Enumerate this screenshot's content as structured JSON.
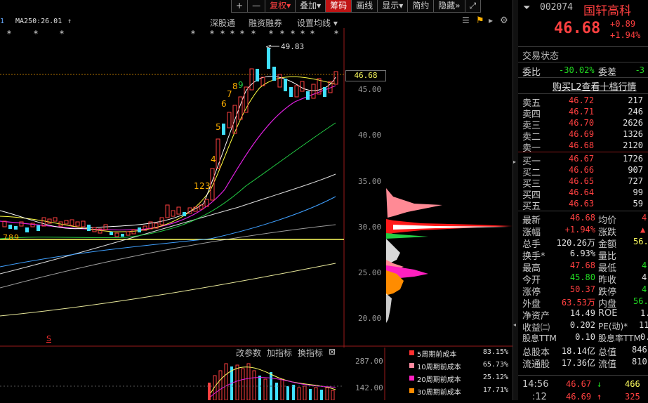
{
  "toolbar": {
    "buttons": [
      "+",
      "—",
      "复权",
      "叠加",
      "筹码",
      "画线",
      "显示",
      "简约",
      "隐藏"
    ],
    "more": "»",
    "expand": "⤢"
  },
  "chart_header": {
    "ma250": "MA250:26.01",
    "arrow": "↑",
    "menu1": "深股通",
    "menu2": "融资融券",
    "menu3": "设置均线",
    "annot_high": "49.83",
    "price_tag": "46.68",
    "nums": [
      "4",
      "5",
      "6",
      "7",
      "8",
      "9",
      "1",
      "2",
      "3"
    ],
    "seq_left": "789",
    "s_marker": "S"
  },
  "y_axis": [
    "45.00",
    "40.00",
    "35.00",
    "30.00",
    "25.00",
    "20.00"
  ],
  "sub_axis": [
    "287.00",
    "142.00"
  ],
  "sub_menu": [
    "改参数",
    "加指标",
    "换指标"
  ],
  "sub_close": "⊠",
  "legend": [
    {
      "name": "5周期前成本",
      "value": "83.15%",
      "color": "#ff3030"
    },
    {
      "name": "10周期前成本",
      "value": "65.73%",
      "color": "#ff8aa0"
    },
    {
      "name": "20周期前成本",
      "value": "25.12%",
      "color": "#ff20c0"
    },
    {
      "name": "30周期前成本",
      "value": "17.71%",
      "color": "#ff8c00"
    }
  ],
  "side": {
    "code": "002074",
    "name": "国轩高科",
    "price": "46.68",
    "change": "+0.89",
    "pct": "+1.94%",
    "status": "交易状态",
    "weibi_label": "委比",
    "weibi_value": "-30.02%",
    "weicha_label": "委差",
    "weicha_value": "-3",
    "l2_link": "购买L2查看十档行情",
    "asks": [
      {
        "label": "卖五",
        "price": "46.72",
        "vol": "217"
      },
      {
        "label": "卖四",
        "price": "46.71",
        "vol": "246"
      },
      {
        "label": "卖三",
        "price": "46.70",
        "vol": "2626"
      },
      {
        "label": "卖二",
        "price": "46.69",
        "vol": "1326"
      },
      {
        "label": "卖一",
        "price": "46.68",
        "vol": "2120"
      }
    ],
    "bids": [
      {
        "label": "买一",
        "price": "46.67",
        "vol": "1726"
      },
      {
        "label": "买二",
        "price": "46.66",
        "vol": "907"
      },
      {
        "label": "买三",
        "price": "46.65",
        "vol": "727"
      },
      {
        "label": "买四",
        "price": "46.64",
        "vol": "99"
      },
      {
        "label": "买五",
        "price": "46.63",
        "vol": "59"
      }
    ],
    "stats": [
      {
        "l1": "最新",
        "v1": "46.68",
        "l2": "均价",
        "v2": "4"
      },
      {
        "l1": "涨幅",
        "v1": "+1.94%",
        "l2": "涨跌",
        "v2": "▲"
      },
      {
        "l1": "总手",
        "v1": "120.26万",
        "l2": "金额",
        "v2": "56."
      },
      {
        "l1": "换手*",
        "v1": "6.93%",
        "l2": "量比",
        "v2": ""
      },
      {
        "l1": "最高",
        "v1": "47.68",
        "l2": "最低",
        "v2": "4"
      },
      {
        "l1": "今开",
        "v1": "45.80",
        "l2": "昨收",
        "v2": "4"
      },
      {
        "l1": "涨停",
        "v1": "50.37",
        "l2": "跌停",
        "v2": "4"
      },
      {
        "l1": "外盘",
        "v1": "63.53万",
        "l2": "内盘",
        "v2": "56.7"
      },
      {
        "l1": "净资产",
        "v1": "14.49",
        "l2": "ROE",
        "v2": "1."
      },
      {
        "l1": "收益㈡",
        "v1": "0.202",
        "l2": "PE(动)*",
        "v2": "11"
      },
      {
        "l1": "股息TTM",
        "v1": "0.10",
        "l2": "股息率TTM",
        "v2": "0."
      },
      {
        "l1": "总股本",
        "v1": "18.14亿",
        "l2": "总值",
        "v2": "846"
      },
      {
        "l1": "流通股",
        "v1": "17.36亿",
        "l2": "流值",
        "v2": "810"
      }
    ],
    "ticks": [
      {
        "time": "14:56",
        "price": "46.67",
        "dir": "↓",
        "vol": "466"
      },
      {
        "time": ":12",
        "price": "46.69",
        "dir": "↑",
        "vol": "325"
      }
    ]
  }
}
